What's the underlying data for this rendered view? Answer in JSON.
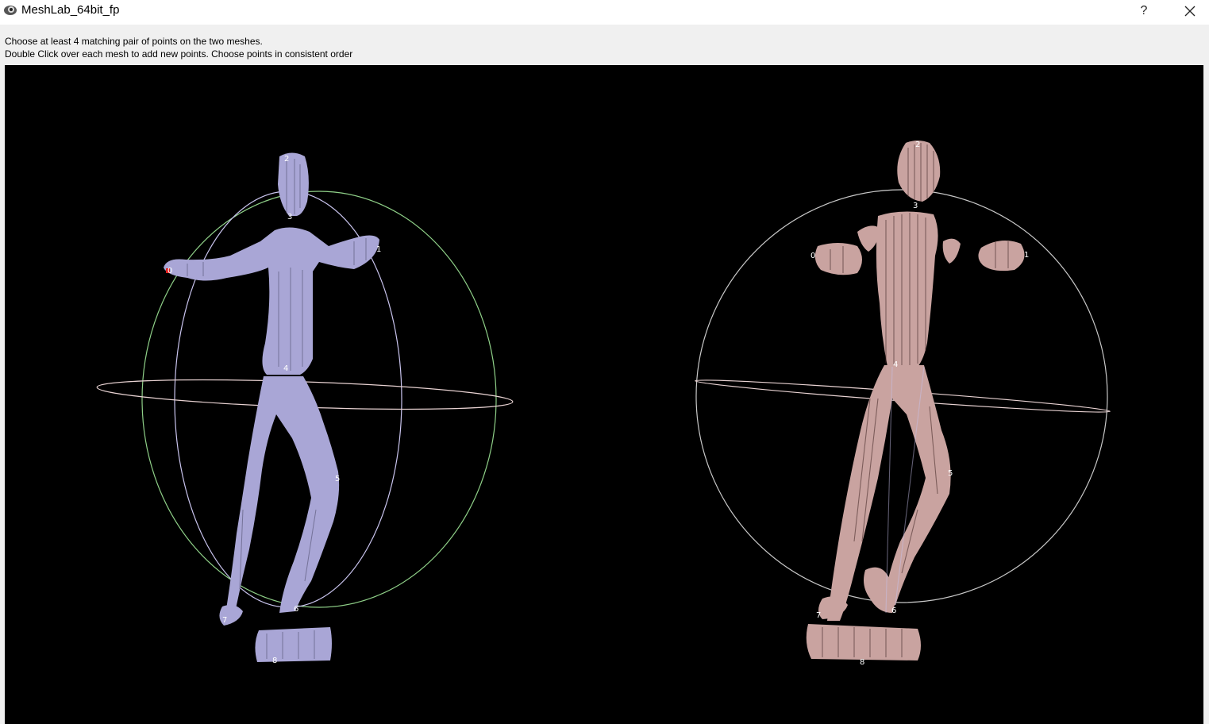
{
  "window": {
    "title": "MeshLab_64bit_fp",
    "help_label": "?",
    "close_icon": "close-icon",
    "app_icon": "meshlab-eye-icon"
  },
  "instructions": {
    "line1": "Choose at least 4 matching pair of points on the two meshes.",
    "line2": "Double Click over each mesh to add new points. Choose points in consistent order"
  },
  "viewer": {
    "background": "#000000",
    "left_mesh": {
      "name": "left-mesh",
      "color": "#a9a6d6",
      "points": [
        "0",
        "1",
        "2",
        "3",
        "4",
        "5",
        "6",
        "7",
        "8"
      ]
    },
    "right_mesh": {
      "name": "right-mesh",
      "color": "#c9a3a0",
      "points": [
        "0",
        "1",
        "2",
        "3",
        "4",
        "5",
        "6",
        "7",
        "8"
      ]
    }
  }
}
